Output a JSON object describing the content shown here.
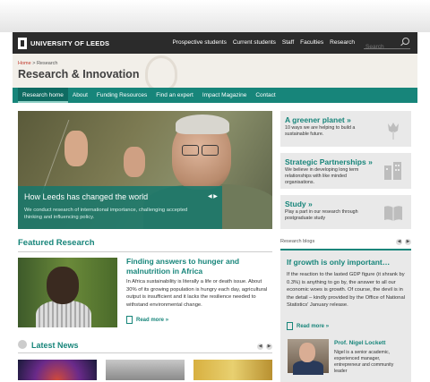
{
  "topbar": {
    "logo": "UNIVERSITY OF LEEDS",
    "links": [
      "Prospective students",
      "Current students",
      "Staff",
      "Faculties",
      "Research"
    ],
    "search_placeholder": "Search"
  },
  "header": {
    "breadcrumb_home": "Home",
    "breadcrumb_sep": " > ",
    "breadcrumb_current": "Research",
    "title": "Research & Innovation"
  },
  "nav": {
    "items": [
      "Research home",
      "About",
      "Funding Resources",
      "Find an expert",
      "Impact Magazine",
      "Contact"
    ],
    "active": "Research home"
  },
  "hero": {
    "title": "How Leeds has changed the world",
    "desc": "We conduct research of international importance, challenging accepted thinking and influencing policy."
  },
  "promos": [
    {
      "title": "A greener planet",
      "desc": "10 ways we are helping to build a sustainable future.",
      "icon": "tulip-icon"
    },
    {
      "title": "Strategic Partnerships",
      "desc": "We believe in developing long term relationships with like minded organisations.",
      "icon": "buildings-icon"
    },
    {
      "title": "Study",
      "desc": "Play a part in our research through postgraduate study",
      "icon": "book-icon"
    }
  ],
  "featured": {
    "heading": "Featured Research",
    "title": "Finding answers to hunger and malnutrition in Africa",
    "desc": "In Africa sustainability is literally a life or death issue. About 30% of its growing population is hungry each day, agricultural output is insufficient and it lacks the resilience needed to withstand environmental change.",
    "more": "Read more"
  },
  "news": {
    "heading": "Latest News"
  },
  "blog": {
    "label": "Research blogs",
    "title": "If growth is only important…",
    "desc": "If the reaction to the lasted GDP figure (it shrank by 0.3%) is anything to go by, the answer to all our economic woes is growth. Of course, the devil is in the detail – kindly provided by the Office of National Statistics' January release.",
    "more": "Read more",
    "author": "Prof. Nigel Lockett",
    "author_desc": "Nigel is a senior academic, experienced manager, entrepreneur and community leader"
  },
  "colors": {
    "accent": "#17857a",
    "topbar": "#2b2b2b",
    "header_bg": "#f2efe9"
  }
}
